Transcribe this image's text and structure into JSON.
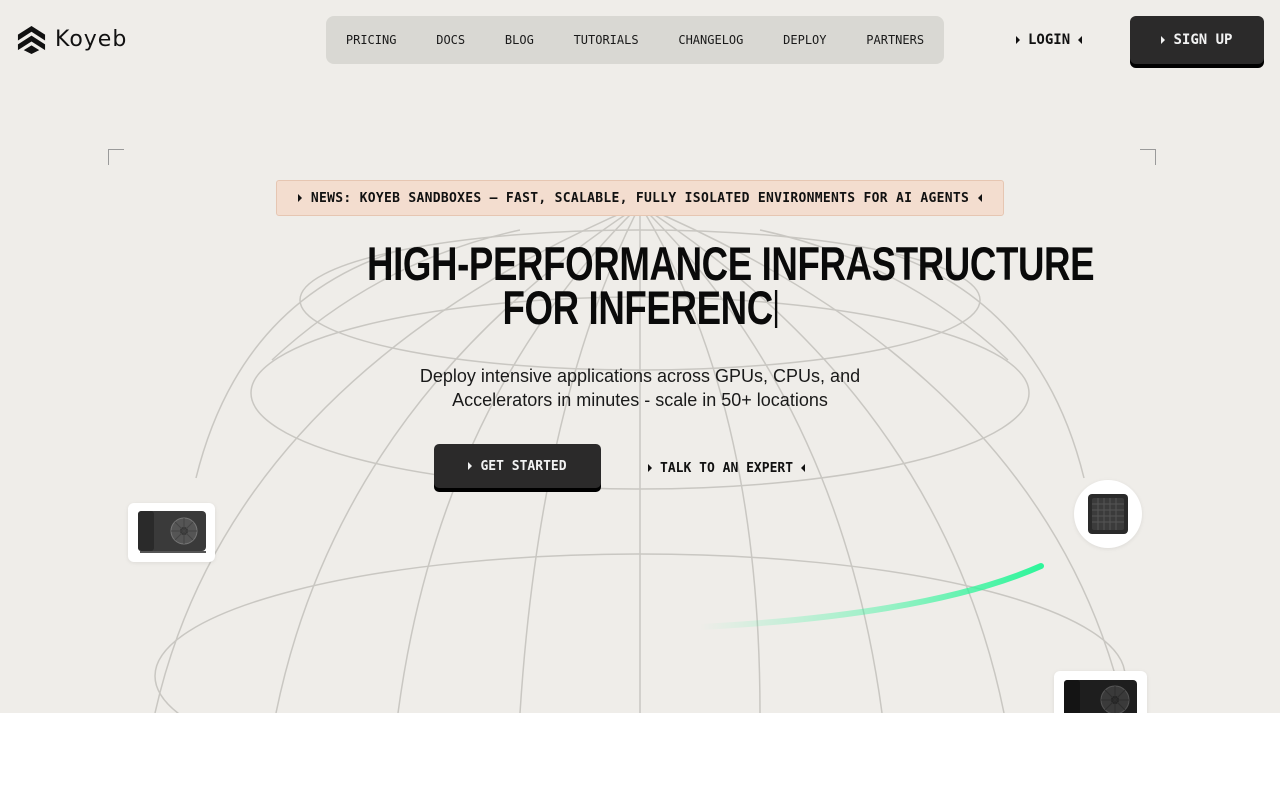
{
  "brand": {
    "name": "Koyeb",
    "logo_icon": "koyeb-logo-icon"
  },
  "nav": {
    "links": [
      "PRICING",
      "DOCS",
      "BLOG",
      "TUTORIALS",
      "CHANGELOG",
      "DEPLOY",
      "PARTNERS"
    ],
    "login_label": "LOGIN",
    "signup_label": "SIGN UP"
  },
  "news": {
    "text": "NEWS: KOYEB SANDBOXES — FAST, SCALABLE, FULLY ISOLATED ENVIRONMENTS FOR AI AGENTS"
  },
  "hero": {
    "title_line1": "HIGH-PERFORMANCE INFRASTRUCTURE",
    "title_line2": "FOR INFERENC",
    "subtitle_line1": "Deploy intensive applications across GPUs, CPUs, and",
    "subtitle_line2": "Accelerators in minutes - scale in 50+ locations",
    "cta_primary": "GET STARTED",
    "cta_secondary": "TALK TO AN EXPERT"
  },
  "decor": {
    "cards": [
      "gpu-card-icon",
      "cpu-chip-icon",
      "gpu-card-icon"
    ],
    "accent_color": "#2ef59a",
    "globe_line_color": "#c9c7c2"
  },
  "colors": {
    "background": "#efede9",
    "nav_pill": "#d9d8d3",
    "dark_button": "#2b2a2a",
    "news_bg": "#f3ddcf"
  }
}
